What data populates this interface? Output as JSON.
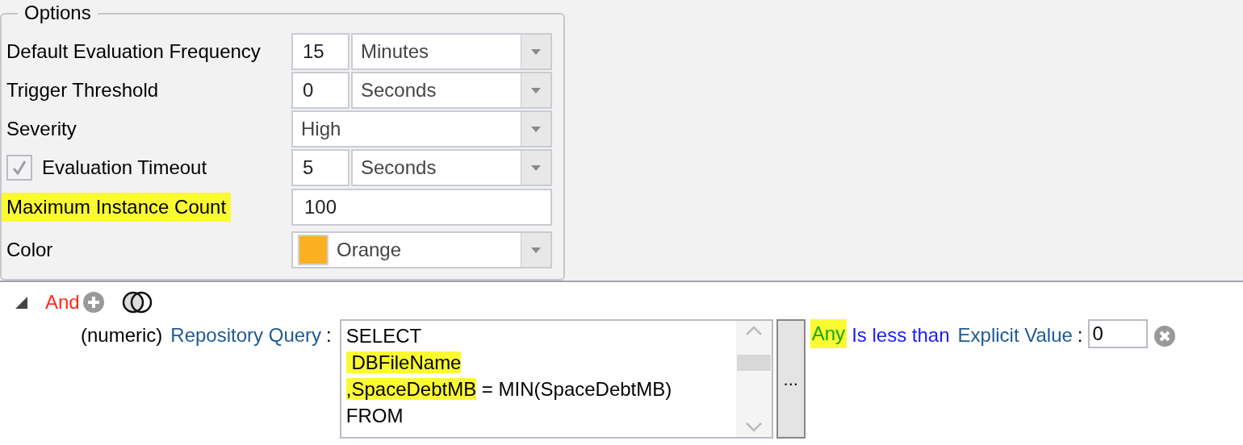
{
  "options": {
    "title": "Options",
    "rows": [
      {
        "kind": "number_unit",
        "label": "Default Evaluation Frequency",
        "highlighted": false,
        "value": "15",
        "unit": "Minutes"
      },
      {
        "kind": "number_unit",
        "label": "Trigger Threshold",
        "highlighted": false,
        "value": "0",
        "unit": "Seconds"
      },
      {
        "kind": "dropdown",
        "label": "Severity",
        "highlighted": false,
        "value": "High"
      },
      {
        "kind": "checkbox_number_unit",
        "label": "Evaluation Timeout",
        "highlighted": false,
        "checked": true,
        "value": "5",
        "unit": "Seconds"
      },
      {
        "kind": "text",
        "label": "Maximum Instance Count",
        "highlighted": true,
        "value": "100"
      },
      {
        "kind": "color",
        "label": "Color",
        "highlighted": false,
        "value": "Orange",
        "color": "#fbb022"
      }
    ]
  },
  "condition": {
    "expanded": true,
    "operator": "And",
    "type": "(numeric)",
    "source": "Repository Query",
    "separator": ":",
    "query_lines": [
      [
        {
          "text": "SELECT",
          "highlighted": false
        }
      ],
      [
        {
          "text": " DBFileName",
          "highlighted": true
        }
      ],
      [
        {
          "text": ",SpaceDebtMB",
          "highlighted": true
        },
        {
          "text": " = MIN(SpaceDebtMB)",
          "highlighted": false
        }
      ],
      [
        {
          "text": "FROM",
          "highlighted": false
        }
      ]
    ],
    "browse_button": "...",
    "quantifier": {
      "text": "Any",
      "highlighted": true
    },
    "comparison": "Is less than",
    "value_source": "Explicit Value",
    "value_separator": ":",
    "value": "0"
  }
}
